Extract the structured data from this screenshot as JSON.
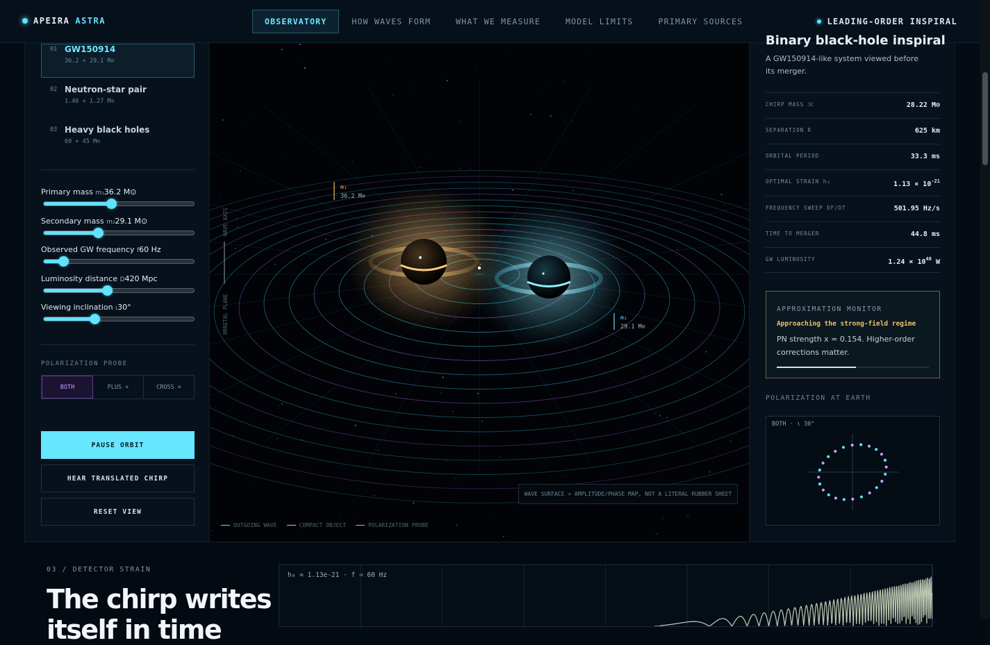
{
  "brand": {
    "name": "APEIRA",
    "accent": "ASTRA"
  },
  "nav": {
    "tabs": [
      "OBSERVATORY",
      "HOW WAVES FORM",
      "WHAT WE MEASURE",
      "MODEL LIMITS",
      "PRIMARY SOURCES"
    ],
    "status": "LEADING-ORDER INSPIRAL"
  },
  "presets": [
    {
      "num": "01",
      "name": "GW150914",
      "sub": "36.2 + 29.1 M⊙"
    },
    {
      "num": "02",
      "name": "Neutron-star pair",
      "sub": "1.46 + 1.27 M⊙"
    },
    {
      "num": "03",
      "name": "Heavy black holes",
      "sub": "60 + 45 M⊙"
    }
  ],
  "sliders": [
    {
      "label": "Primary mass ",
      "sym": "m₁",
      "value": "36.2 M⊙",
      "fraction": 0.45
    },
    {
      "label": "Secondary mass ",
      "sym": "m₂",
      "value": "29.1 M⊙",
      "fraction": 0.36
    },
    {
      "label": "Observed GW frequency ",
      "sym": "f",
      "value": "60 Hz",
      "fraction": 0.13
    },
    {
      "label": "Luminosity distance ",
      "sym": "D",
      "value": "420 Mpc",
      "fraction": 0.42
    },
    {
      "label": "Viewing inclination ",
      "sym": "ι",
      "value": "30°",
      "fraction": 0.34
    }
  ],
  "polarization": {
    "label": "POLARIZATION PROBE",
    "options": [
      "BOTH",
      "PLUS +",
      "CROSS ×"
    ],
    "selected": "BOTH"
  },
  "buttons": {
    "pause": "PAUSE ORBIT",
    "chirp": "HEAR TRANSLATED CHIRP",
    "reset": "RESET VIEW"
  },
  "viz": {
    "m1_label": "m₁",
    "m1_value": "36.2 M⊙",
    "m2_label": "m₂",
    "m2_value": "29.1 M⊙",
    "axis_wave": "WAVE AXIS",
    "axis_plane": "ORBITAL PLANE",
    "note": "WAVE SURFACE = AMPLITUDE/PHASE MAP, NOT A LITERAL RUBBER SHEET",
    "legend": [
      "OUTGOING WAVE",
      "COMPACT OBJECT",
      "POLARIZATION PROBE"
    ]
  },
  "system": {
    "title": "Binary black-hole inspiral",
    "desc": "A GW150914-like system viewed before its merger."
  },
  "metrics": [
    {
      "key": "CHIRP MASS ℳ",
      "value": "28.22 M⊙"
    },
    {
      "key": "SEPARATION R",
      "value": "625 km"
    },
    {
      "key": "ORBITAL PERIOD",
      "value": "33.3 ms"
    },
    {
      "key": "OPTIMAL STRAIN h₀",
      "value": "1.13 × 10",
      "exp": "-21"
    },
    {
      "key": "FREQUENCY SWEEP DF/DT",
      "value": "501.95 Hz/s"
    },
    {
      "key": "TIME TO MERGER",
      "value": "44.8 ms"
    },
    {
      "key": "GW LUMINOSITY",
      "value": "1.24 × 10",
      "exp": "48",
      "unit": " W"
    }
  ],
  "monitor": {
    "title": "APPROXIMATION MONITOR",
    "status": "Approaching the strong-field regime",
    "detail": "PN strength x = 0.154. Higher-order corrections matter.",
    "fraction": 0.52
  },
  "pol_earth": {
    "title": "POLARIZATION AT EARTH",
    "label": "BOTH · ι 30°"
  },
  "bottom": {
    "section": "03 / DETECTOR STRAIN",
    "heading": "The chirp writes itself in time",
    "strain_label": "h₀ = 1.13e-21  ·  f = 60 Hz"
  },
  "colors": {
    "accent": "#5fe3ff",
    "warm": "#f0c067",
    "violet": "#c79bff"
  }
}
